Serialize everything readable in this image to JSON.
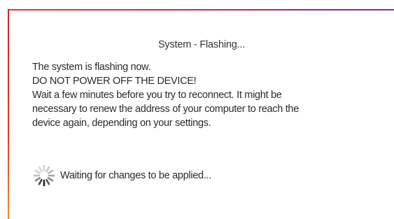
{
  "dialog": {
    "title": "System - Flashing...",
    "lines": [
      "The system is flashing now.",
      "DO NOT POWER OFF THE DEVICE!",
      "Wait a few minutes before you try to reconnect. It might be",
      "necessary to renew the address of your computer to reach the",
      "device again, depending on your settings."
    ],
    "status_text": "Waiting for changes to be applied...",
    "spinner_icon": "loading-spinner-icon"
  },
  "colors": {
    "border_red": "#e23b2e",
    "border_purple": "#7a2bb0",
    "border_orange": "#f08a1e",
    "text": "#2b2b2b"
  }
}
